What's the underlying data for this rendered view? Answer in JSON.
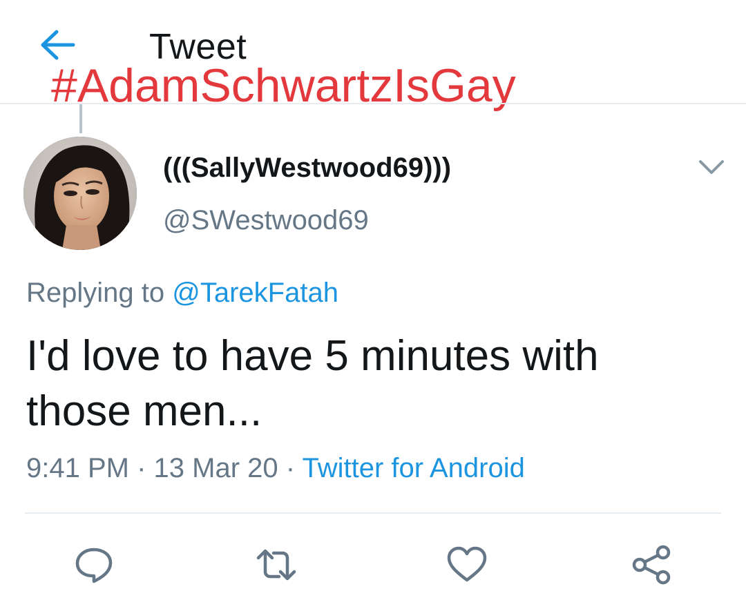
{
  "header": {
    "title": "Tweet",
    "back_icon": "arrow-left-icon"
  },
  "overlay": {
    "hashtag": "#AdamSchwartzIsGay"
  },
  "tweet": {
    "author": {
      "display_name": "(((SallyWestwood69)))",
      "handle": "@SWestwood69",
      "avatar_icon": "avatar-photo"
    },
    "replying_prefix": "Replying to",
    "replying_to": "@TarekFatah",
    "text_line1": "I'd love to have 5 minutes with",
    "text_line2": "those men...",
    "time": "9:41 PM",
    "date": "13 Mar 20",
    "separator": "·",
    "source": "Twitter for Android"
  },
  "actions": [
    {
      "name": "reply",
      "icon": "comment-icon"
    },
    {
      "name": "retweet",
      "icon": "retweet-icon"
    },
    {
      "name": "like",
      "icon": "heart-icon"
    },
    {
      "name": "share",
      "icon": "share-icon"
    }
  ],
  "colors": {
    "accent": "#1b95e0",
    "overlay_red": "#e3383c",
    "secondary_text": "#657786",
    "primary_text": "#14171a"
  }
}
